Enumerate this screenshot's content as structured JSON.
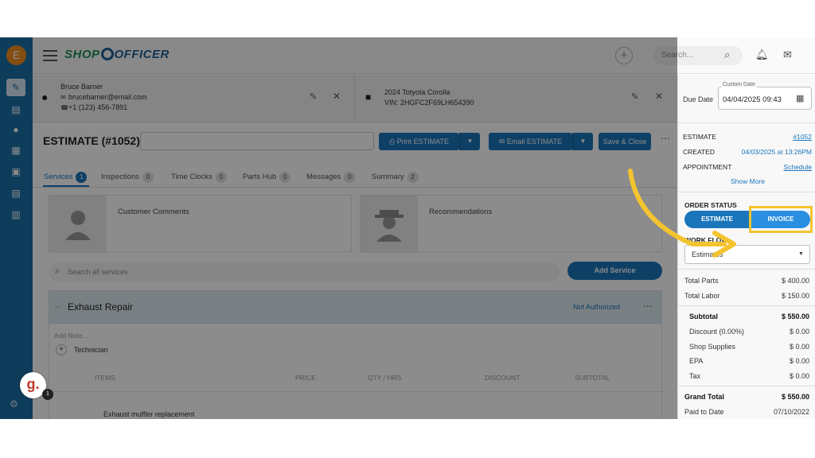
{
  "user": {
    "avatar_letter": "E"
  },
  "brand": {
    "part1": "SHOP",
    "part2": "OFFICER"
  },
  "topbar": {
    "search_placeholder": "Search..."
  },
  "customer": {
    "name": "Bruce Barner",
    "email": "brucebarner@email.com",
    "phone": "+1 (123) 456-7891"
  },
  "vehicle": {
    "name": "2024 Totyota Corolla",
    "vin": "VIN: 2HGFC2F69LH654390"
  },
  "estimate": {
    "title": "ESTIMATE (#1052)",
    "print_label": "Print ESTIMATE",
    "email_label": "Email ESTIMATE",
    "save_close_label": "Save & Close"
  },
  "tabs": [
    {
      "label": "Services",
      "count": "1"
    },
    {
      "label": "Inspections",
      "count": "0"
    },
    {
      "label": "Time Clocks",
      "count": "0"
    },
    {
      "label": "Parts Hub",
      "count": "0"
    },
    {
      "label": "Messages",
      "count": "0"
    },
    {
      "label": "Summary",
      "count": "2"
    }
  ],
  "cards": {
    "customer_comments": "Customer Comments",
    "recommendations": "Recommendations"
  },
  "services": {
    "search_placeholder": "Search all services",
    "add_service_label": "Add Service",
    "block": {
      "title": "Exhaust Repair",
      "status": "Not Authorized",
      "add_note": "Add Note...",
      "technician_label": "Technician",
      "columns": [
        "ITEMS",
        "PRICE",
        "QTY / HRS",
        "DISCOUNT",
        "SUBTOTAL"
      ],
      "item": "Exhaust muffler replacement"
    }
  },
  "guide_badge": {
    "letter": "g.",
    "count": "1"
  },
  "right_panel": {
    "due_date_label": "Due Date",
    "custom_date_legend": "Custom Date",
    "due_date_value": "04/04/2025 09:43",
    "estimate_label": "ESTIMATE",
    "estimate_value": "#1052",
    "created_label": "CREATED",
    "created_value": "04/03/2025 at 13:26PM",
    "appointment_label": "APPOINTMENT",
    "appointment_value": "Schedule",
    "show_more": "Show More",
    "order_status_label": "ORDER STATUS",
    "estimate_pill": "ESTIMATE",
    "invoice_label": "INVOICE",
    "workflow_label": "WORK FLOW",
    "workflow_value": "Estimates",
    "totals": {
      "total_parts_label": "Total Parts",
      "total_parts": "$ 400.00",
      "total_labor_label": "Total Labor",
      "total_labor": "$ 150.00",
      "subtotal_label": "Subtotal",
      "subtotal": "$ 550.00",
      "discount_label": "Discount (0.00%)",
      "discount": "$ 0.00",
      "shop_supplies_label": "Shop Supplies",
      "shop_supplies": "$ 0.00",
      "epa_label": "EPA",
      "epa": "$ 0.00",
      "tax_label": "Tax",
      "tax": "$ 0.00",
      "grand_total_label": "Grand Total",
      "grand_total": "$ 550.00",
      "paid_to_date_label": "Paid to Date",
      "paid_to_date": "07/10/2022"
    }
  },
  "colors": {
    "accent": "#1b75bb",
    "highlight": "#f4c430",
    "nav": "#1b6fa8"
  }
}
